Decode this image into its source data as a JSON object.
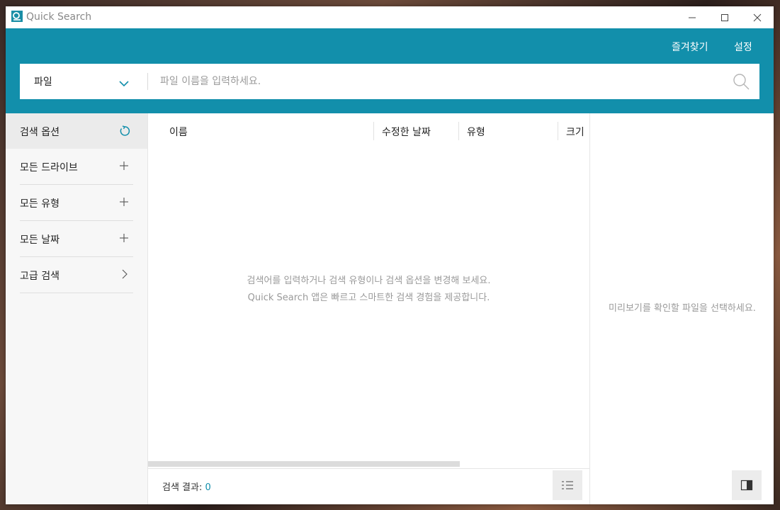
{
  "app": {
    "title": "Quick Search"
  },
  "header": {
    "favorites_label": "즐겨찾기",
    "settings_label": "설정"
  },
  "search": {
    "scope": "파일",
    "placeholder": "파일 이름을 입력하세요."
  },
  "sidebar": {
    "items": [
      {
        "label": "검색 옵션",
        "icon": "refresh-icon"
      },
      {
        "label": "모든 드라이브",
        "icon": "plus-icon"
      },
      {
        "label": "모든 유형",
        "icon": "plus-icon"
      },
      {
        "label": "모든 날짜",
        "icon": "plus-icon"
      },
      {
        "label": "고급 검색",
        "icon": "chevron-right-icon"
      }
    ]
  },
  "results": {
    "columns": [
      "이름",
      "수정한 날짜",
      "유형",
      "크기"
    ],
    "empty_line1": "검색어를 입력하거나 검색 유형이나 검색 옵션을 변경해 보세요.",
    "empty_line2": "Quick Search 앱은 빠르고 스마트한 검색 경험을 제공합니다.",
    "count_label": "검색 결과:",
    "count_value": "0"
  },
  "preview": {
    "message": "미리보기를 확인할 파일을 선택하세요."
  },
  "colors": {
    "accent": "#128fab"
  }
}
